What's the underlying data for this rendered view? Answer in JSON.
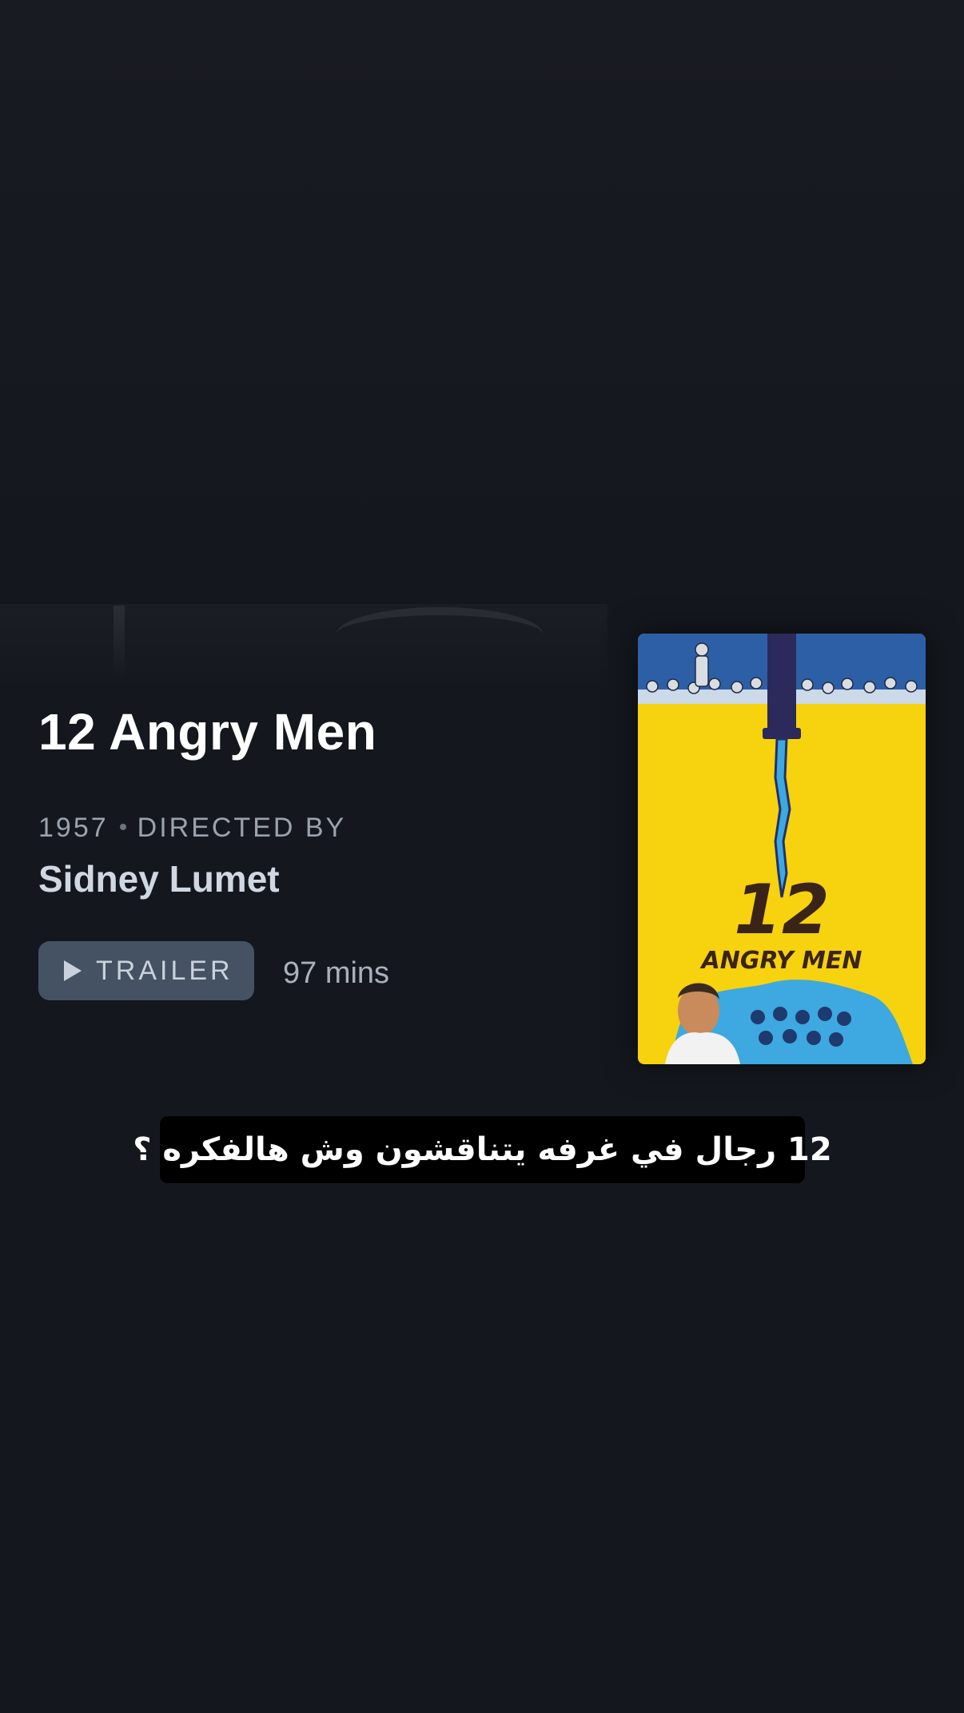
{
  "movie": {
    "title": "12 Angry Men",
    "year": "1957",
    "directed_by_label": "DIRECTED BY",
    "director": "Sidney Lumet",
    "trailer_label": "TRAILER",
    "runtime": "97 mins"
  },
  "poster": {
    "number": "12",
    "name": "ANGRY MEN",
    "colors": {
      "background": "#f7d20e",
      "top_band": "#2d5fa6",
      "accent_blue": "#3ea8e0",
      "knife": "#2b2a5a"
    }
  },
  "caption": {
    "text": "12 رجال في غرفه يتناقشون وش هالفكره ؟"
  },
  "icons": {
    "trailer": "play-icon"
  },
  "colors": {
    "background": "#14181e",
    "button": "#445263",
    "title": "#ffffff",
    "director": "#cfd8e2"
  }
}
